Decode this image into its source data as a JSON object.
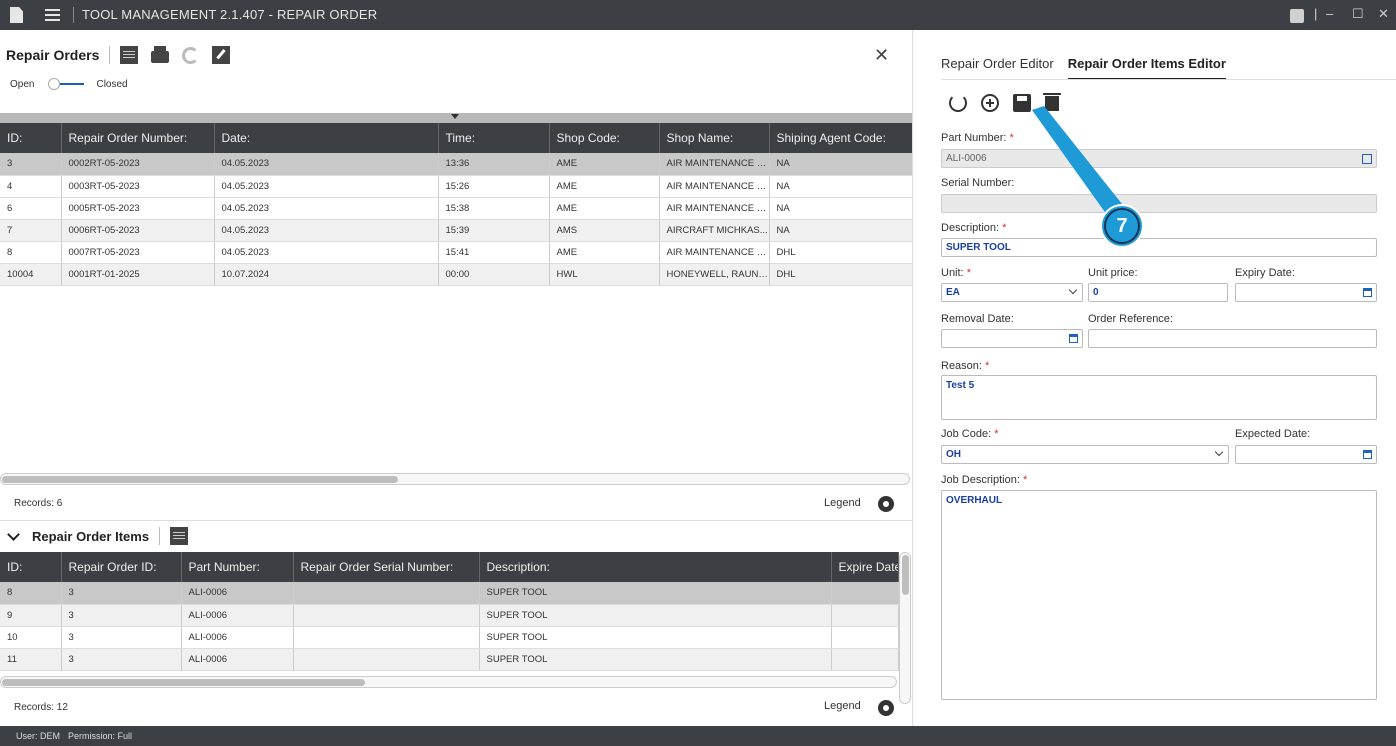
{
  "window": {
    "title": "TOOL MANAGEMENT 2.1.407 - REPAIR ORDER",
    "controls": [
      "–",
      "☐",
      "✕"
    ]
  },
  "repair_orders": {
    "title": "Repair Orders",
    "toggle": {
      "left": "Open",
      "right": "Closed"
    },
    "columns": [
      "ID:",
      "Repair Order Number:",
      "Date:",
      "Time:",
      "Shop Code:",
      "Shop Name:",
      "Shiping Agent Code:"
    ],
    "rows": [
      [
        "3",
        "0002RT-05-2023",
        "04.05.2023",
        "13:36",
        "AME",
        "AIR MAINTENANCE E...",
        "NA"
      ],
      [
        "4",
        "0003RT-05-2023",
        "04.05.2023",
        "15:26",
        "AME",
        "AIR MAINTENANCE E...",
        "NA"
      ],
      [
        "6",
        "0005RT-05-2023",
        "04.05.2023",
        "15:38",
        "AME",
        "AIR MAINTENANCE E...",
        "NA"
      ],
      [
        "7",
        "0006RT-05-2023",
        "04.05.2023",
        "15:39",
        "AMS",
        "AIRCRAFT MICHKAS...",
        "NA"
      ],
      [
        "8",
        "0007RT-05-2023",
        "04.05.2023",
        "15:41",
        "AME",
        "AIR MAINTENANCE E...",
        "DHL"
      ],
      [
        "10004",
        "0001RT-01-2025",
        "10.07.2024",
        "00:00",
        "HWL",
        "HONEYWELL, RAUNH...",
        "DHL"
      ]
    ],
    "records": "Records: 6",
    "legend": "Legend"
  },
  "repair_order_items": {
    "title": "Repair Order Items",
    "columns": [
      "ID:",
      "Repair Order ID:",
      "Part Number:",
      "Repair Order Serial Number:",
      "Description:",
      "Expire Date:"
    ],
    "rows": [
      [
        "8",
        "3",
        "ALI-0006",
        "",
        "SUPER TOOL",
        ""
      ],
      [
        "9",
        "3",
        "ALI-0006",
        "",
        "SUPER TOOL",
        ""
      ],
      [
        "10",
        "3",
        "ALI-0006",
        "",
        "SUPER TOOL",
        ""
      ],
      [
        "11",
        "3",
        "ALI-0006",
        "",
        "SUPER TOOL",
        ""
      ]
    ],
    "records": "Records: 12",
    "legend": "Legend"
  },
  "editor": {
    "tabs": [
      "Repair Order Editor",
      "Repair Order Items Editor"
    ],
    "active_tab": 1,
    "fields": {
      "part_number": {
        "label": "Part Number:",
        "value": "ALI-0006"
      },
      "serial_number": {
        "label": "Serial Number:",
        "value": ""
      },
      "description": {
        "label": "Description:",
        "value": "SUPER TOOL"
      },
      "unit": {
        "label": "Unit:",
        "value": "EA"
      },
      "unit_price": {
        "label": "Unit price:",
        "value": "0"
      },
      "expiry_date": {
        "label": "Expiry Date:",
        "value": ""
      },
      "removal_date": {
        "label": "Removal Date:",
        "value": ""
      },
      "order_reference": {
        "label": "Order Reference:",
        "value": ""
      },
      "reason": {
        "label": "Reason:",
        "value": "Test 5"
      },
      "job_code": {
        "label": "Job Code:",
        "value": "OH"
      },
      "expected_date": {
        "label": "Expected Date:",
        "value": ""
      },
      "job_description": {
        "label": "Job Description:",
        "value": "OVERHAUL"
      }
    },
    "required_mark": "*"
  },
  "callout": {
    "number": "7",
    "color": "#1e9bd7"
  },
  "status": {
    "user": "User: DEM",
    "permission": "Permission: Full"
  },
  "colors": {
    "titlebar": "#3c3f43",
    "accent": "#1a5fb4",
    "required": "#d32f2f",
    "value_text": "#1a3fa0"
  }
}
